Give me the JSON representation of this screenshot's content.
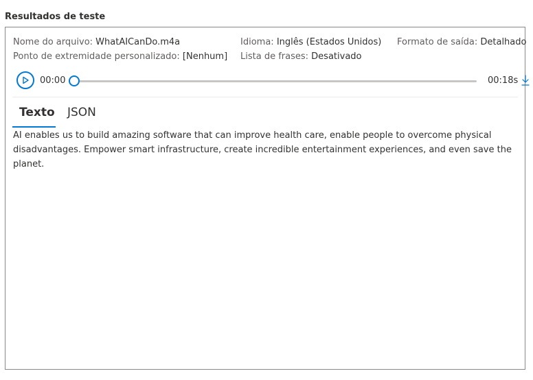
{
  "section_title": "Resultados de teste",
  "meta": {
    "file_label": "Nome do arquivo:",
    "file_value": "WhatAICanDo.m4a",
    "language_label": "Idioma:",
    "language_value": "Inglês (Estados Unidos)",
    "format_label": "Formato de saída:",
    "format_value": "Detalhado",
    "endpoint_label": "Ponto de extremidade personalizado:",
    "endpoint_value": "[Nenhum]",
    "phrases_label": "Lista de frases:",
    "phrases_value": "Desativado"
  },
  "player": {
    "current_time": "00:00",
    "duration": "00:18s",
    "progress": 0
  },
  "tabs": [
    {
      "label": "Texto",
      "active": true
    },
    {
      "label": "JSON",
      "active": false
    }
  ],
  "transcript": "AI enables us to build amazing software that can improve health care, enable people to overcome physical disadvantages. Empower smart infrastructure, create incredible entertainment experiences, and even save the planet.",
  "colors": {
    "accent": "#0078d4",
    "track": "#c8c6c4",
    "border": "#8a8886",
    "text": "#323130"
  },
  "icons": {
    "play": "play-icon",
    "download": "download-icon"
  }
}
